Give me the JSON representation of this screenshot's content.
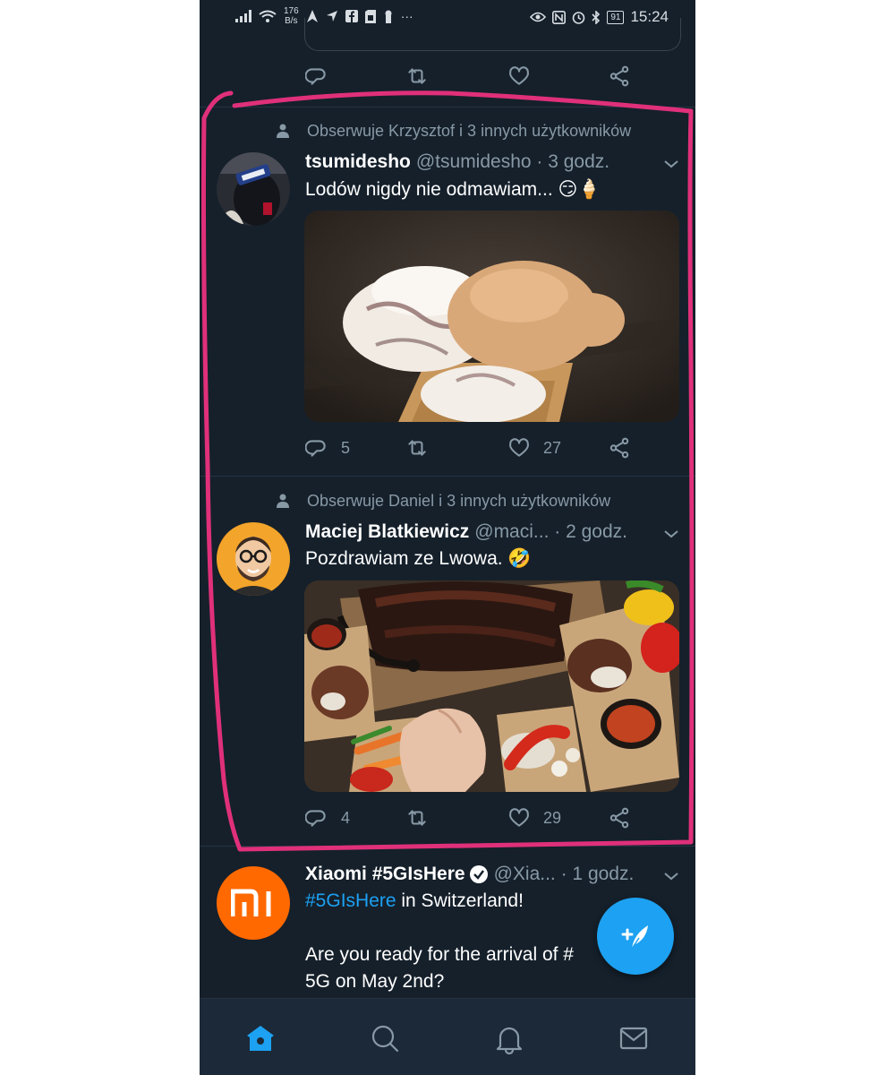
{
  "status_bar": {
    "net_speed_value": "176",
    "net_speed_unit": "B/s",
    "more": "···",
    "battery": "91",
    "time": "15:24"
  },
  "tweets": [
    {
      "social_context": "Obserwuje Krzysztof i 3 innych użytkowników",
      "name": "tsumidesho",
      "meta": "@tsumidesho · 3 godz.",
      "text": "Lodów nigdy nie odmawiam... 😏🍦",
      "replies": "5",
      "likes": "27"
    },
    {
      "social_context": "Obserwuje Daniel i 3 innych użytkowników",
      "name": "Maciej Blatkiewicz",
      "meta": "@maci... · 2 godz.",
      "text": "Pozdrawiam ze Lwowa. 🤣",
      "replies": "4",
      "likes": "29"
    },
    {
      "name": "Xiaomi #5GIsHere",
      "meta": "@Xia... · 1 godz.",
      "hashtag_line1": "#5GIsHere",
      "line1_rest": " in Switzerland!",
      "line2": "Are you ready for the arrival of #",
      "line3": "5G on May 2nd?",
      "avatar_text": "mi"
    }
  ],
  "colors": {
    "background": "#15202b",
    "accent": "#1da1f2",
    "secondary_text": "#8899a6",
    "annotation": "#e0307a",
    "xiaomi_orange": "#ff6900"
  },
  "icons": {
    "reply": "reply-icon",
    "retweet": "retweet-icon",
    "like": "like-icon",
    "share": "share-icon",
    "home": "home-icon",
    "search": "search-icon",
    "notifications": "bell-icon",
    "messages": "mail-icon",
    "compose": "compose-icon",
    "verified": "verified-badge-icon"
  }
}
